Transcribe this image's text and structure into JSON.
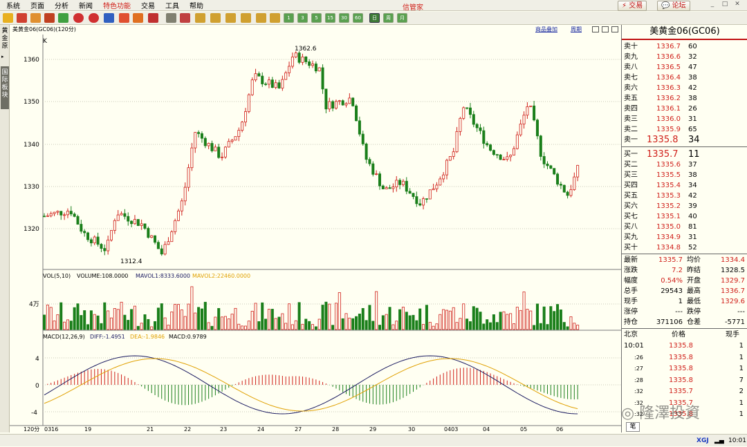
{
  "menu": [
    "系统",
    "页面",
    "分析",
    "新闻",
    "特色功能",
    "交易",
    "工具",
    "帮助"
  ],
  "app_title": "信管家",
  "top_buttons": {
    "trade": "交易",
    "forum": "论坛"
  },
  "toolbar_period_buttons": [
    "1",
    "3",
    "5",
    "15",
    "30",
    "60",
    "日",
    "周",
    "月"
  ],
  "sidebar": {
    "tab1": "黄金原",
    "tab2": "国际板块"
  },
  "chart": {
    "header_title": "美黄金06(GC06)(120分)",
    "k_label": "K",
    "link_overlay": "商品叠加",
    "link_period": "周期",
    "max_label": "1362.6",
    "min_label": "1312.4",
    "price_ticks": [
      "1360",
      "1350",
      "1340",
      "1330",
      "1320"
    ],
    "vol_title": "VOL(5,10)",
    "vol_volume": "VOLUME:108.0000",
    "vol_mavol1": "MAVOL1:8333.6000",
    "vol_mavol2": "MAVOL2:22460.0000",
    "vol_tick": "4万",
    "macd_title": "MACD(12,26,9)",
    "macd_diff": "DIFF:-1.4951",
    "macd_dea": "DEA:-1.9846",
    "macd_val": "MACD:0.9789",
    "macd_ticks": [
      "4",
      "0",
      "-4"
    ],
    "period_label": "120分",
    "x_labels": [
      "0316",
      "19",
      "21",
      "22",
      "23",
      "24",
      "27",
      "28",
      "29",
      "30",
      "0403",
      "04",
      "05",
      "06"
    ]
  },
  "quote": {
    "title": "美黄金06(GC06)",
    "asks": [
      {
        "label": "卖十",
        "price": "1336.7",
        "vol": "60"
      },
      {
        "label": "卖九",
        "price": "1336.6",
        "vol": "32"
      },
      {
        "label": "卖八",
        "price": "1336.5",
        "vol": "47"
      },
      {
        "label": "卖七",
        "price": "1336.4",
        "vol": "38"
      },
      {
        "label": "卖六",
        "price": "1336.3",
        "vol": "42"
      },
      {
        "label": "卖五",
        "price": "1336.2",
        "vol": "38"
      },
      {
        "label": "卖四",
        "price": "1336.1",
        "vol": "26"
      },
      {
        "label": "卖三",
        "price": "1336.0",
        "vol": "31"
      },
      {
        "label": "卖二",
        "price": "1335.9",
        "vol": "65"
      },
      {
        "label": "卖一",
        "price": "1335.8",
        "vol": "34"
      }
    ],
    "bids": [
      {
        "label": "买一",
        "price": "1335.7",
        "vol": "11"
      },
      {
        "label": "买二",
        "price": "1335.6",
        "vol": "37"
      },
      {
        "label": "买三",
        "price": "1335.5",
        "vol": "38"
      },
      {
        "label": "买四",
        "price": "1335.4",
        "vol": "34"
      },
      {
        "label": "买五",
        "price": "1335.3",
        "vol": "42"
      },
      {
        "label": "买六",
        "price": "1335.2",
        "vol": "39"
      },
      {
        "label": "买七",
        "price": "1335.1",
        "vol": "40"
      },
      {
        "label": "买八",
        "price": "1335.0",
        "vol": "81"
      },
      {
        "label": "买九",
        "price": "1334.9",
        "vol": "31"
      },
      {
        "label": "买十",
        "price": "1334.8",
        "vol": "52"
      }
    ],
    "stats": [
      {
        "l1": "最新",
        "v1": "1335.7",
        "l2": "均价",
        "v2": "1334.4"
      },
      {
        "l1": "涨跌",
        "v1": "7.2",
        "l2": "昨结",
        "v2": "1328.5"
      },
      {
        "l1": "幅度",
        "v1": "0.54%",
        "l2": "开盘",
        "v2": "1329.7"
      },
      {
        "l1": "总手",
        "v1": "29543",
        "l2": "最高",
        "v2": "1336.7"
      },
      {
        "l1": "现手",
        "v1": "1",
        "l2": "最低",
        "v2": "1329.6"
      },
      {
        "l1": "涨停",
        "v1": "---",
        "l2": "跌停",
        "v2": "---"
      },
      {
        "l1": "持仓",
        "v1": "371106",
        "l2": "仓差",
        "v2": "-5771"
      }
    ],
    "ticks_header": {
      "time": "北京",
      "price": "价格",
      "vol": "现手"
    },
    "ticks": [
      {
        "time": "10:01",
        "price": "1335.8",
        "vol": "1"
      },
      {
        "time": ":26",
        "price": "1335.8",
        "vol": "1"
      },
      {
        "time": ":27",
        "price": "1335.8",
        "vol": "1"
      },
      {
        "time": ":28",
        "price": "1335.8",
        "vol": "7"
      },
      {
        "time": ":32",
        "price": "1335.7",
        "vol": "2"
      },
      {
        "time": ":32",
        "price": "1335.7",
        "vol": "1"
      },
      {
        "time": ":32",
        "price": "1335.8",
        "vol": "1"
      }
    ],
    "bottom_tab": "笔"
  },
  "watermark": "隆澤投資",
  "status": {
    "time": "10:01",
    "logo": "XGJ"
  },
  "colors": {
    "up": "#d0201a",
    "down": "#1a7f1a",
    "bg": "#fffff2",
    "dif": "#1a1a60",
    "dea": "#e0a000"
  }
}
